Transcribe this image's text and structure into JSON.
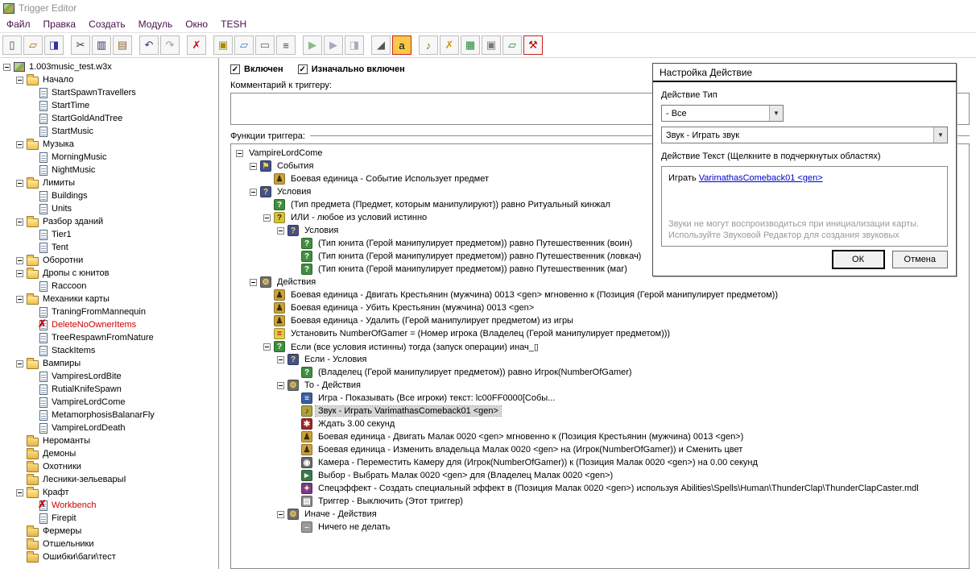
{
  "window": {
    "title": "Trigger Editor"
  },
  "menu": {
    "items": [
      "Файл",
      "Правка",
      "Создать",
      "Модуль",
      "Окно",
      "TESH"
    ]
  },
  "toolbar": {
    "buttons": [
      {
        "name": "new-map",
        "glyph": "▯",
        "color": "#334466"
      },
      {
        "name": "open-map",
        "glyph": "▱",
        "color": "#aa6600"
      },
      {
        "name": "save-map",
        "glyph": "◨",
        "color": "#333399"
      },
      {
        "name": "cut",
        "glyph": "✂",
        "color": "#333333",
        "sep": true
      },
      {
        "name": "copy",
        "glyph": "▥",
        "color": "#333366"
      },
      {
        "name": "paste",
        "glyph": "▤",
        "color": "#886633"
      },
      {
        "name": "undo",
        "glyph": "↶",
        "color": "#333388",
        "sep": true
      },
      {
        "name": "redo",
        "glyph": "↷",
        "color": "#9999aa"
      },
      {
        "name": "delete",
        "glyph": "✗",
        "color": "#cc0000",
        "sep": true
      },
      {
        "name": "new-category",
        "glyph": "▣",
        "color": "#aa8800",
        "sep": true
      },
      {
        "name": "new-trigger",
        "glyph": "▱",
        "color": "#3377cc"
      },
      {
        "name": "new-comment",
        "glyph": "▭",
        "color": "#666666"
      },
      {
        "name": "edit-script",
        "glyph": "≡",
        "color": "#444444"
      },
      {
        "name": "run-trigger",
        "glyph": "▶",
        "color": "#88bb88",
        "sep": true
      },
      {
        "name": "test-map",
        "glyph": "▶",
        "color": "#aaaabb"
      },
      {
        "name": "save-and-test",
        "glyph": "◨",
        "color": "#aaaabb"
      },
      {
        "name": "syntax-check",
        "glyph": "◢",
        "color": "#555555",
        "sep": true
      },
      {
        "name": "syntax-highlight",
        "glyph": "а",
        "color": "#000000",
        "bg": "#f7c948",
        "framed": true
      },
      {
        "name": "sound-manager",
        "glyph": "♪",
        "color": "#777700",
        "sep": true
      },
      {
        "name": "variables",
        "glyph": "✗",
        "color": "#cc9900"
      },
      {
        "name": "object-manager",
        "glyph": "▦",
        "color": "#228833"
      },
      {
        "name": "import-manager",
        "glyph": "▣",
        "color": "#777777"
      },
      {
        "name": "export-script",
        "glyph": "▱",
        "color": "#228833"
      },
      {
        "name": "tesh-settings",
        "glyph": "⚒",
        "color": "#bb0000",
        "framed": true
      }
    ]
  },
  "left_tree": {
    "items": [
      {
        "label": "1.003music_test.w3x",
        "depth": 0,
        "icon": "map",
        "expand": true
      },
      {
        "label": "Начало",
        "depth": 1,
        "icon": "folder-open",
        "expand": true
      },
      {
        "label": "StartSpawnTravellers",
        "depth": 2,
        "icon": "trigger"
      },
      {
        "label": "StartTime",
        "depth": 2,
        "icon": "trigger"
      },
      {
        "label": "StartGoldAndTree",
        "depth": 2,
        "icon": "trigger"
      },
      {
        "label": "StartMusic",
        "depth": 2,
        "icon": "trigger"
      },
      {
        "label": "Музыка",
        "depth": 1,
        "icon": "folder-open",
        "expand": true
      },
      {
        "label": "MorningMusic",
        "depth": 2,
        "icon": "trigger"
      },
      {
        "label": "NightMusic",
        "depth": 2,
        "icon": "trigger"
      },
      {
        "label": "Лимиты",
        "depth": 1,
        "icon": "folder-open",
        "expand": true
      },
      {
        "label": "Buildings",
        "depth": 2,
        "icon": "trigger"
      },
      {
        "label": "Units",
        "depth": 2,
        "icon": "trigger"
      },
      {
        "label": "Разбор зданий",
        "depth": 1,
        "icon": "folder-open",
        "expand": true
      },
      {
        "label": "Tier1",
        "depth": 2,
        "icon": "trigger"
      },
      {
        "label": "Tent",
        "depth": 2,
        "icon": "trigger"
      },
      {
        "label": "Оборотни",
        "depth": 1,
        "icon": "folder-open",
        "expand": true
      },
      {
        "label": "Дропы с юнитов",
        "depth": 1,
        "icon": "folder-open",
        "expand": true
      },
      {
        "label": "Raccoon",
        "depth": 2,
        "icon": "trigger"
      },
      {
        "label": "Механики карты",
        "depth": 1,
        "icon": "folder-open",
        "expand": true
      },
      {
        "label": "TraningFromMannequin",
        "depth": 2,
        "icon": "trigger"
      },
      {
        "label": "DeleteNoOwnerItems",
        "depth": 2,
        "icon": "trigger-disabled",
        "red": true
      },
      {
        "label": "TreeRespawnFromNature",
        "depth": 2,
        "icon": "trigger"
      },
      {
        "label": "StackItems",
        "depth": 2,
        "icon": "trigger"
      },
      {
        "label": "Вампиры",
        "depth": 1,
        "icon": "folder-open",
        "expand": true
      },
      {
        "label": "VampiresLordBite",
        "depth": 2,
        "icon": "trigger"
      },
      {
        "label": "RutialKnifeSpawn",
        "depth": 2,
        "icon": "trigger"
      },
      {
        "label": "VampireLordCome",
        "depth": 2,
        "icon": "trigger"
      },
      {
        "label": "MetamorphosisBalanarFly",
        "depth": 2,
        "icon": "trigger"
      },
      {
        "label": "VampireLordDeath",
        "depth": 2,
        "icon": "trigger"
      },
      {
        "label": "Нероманты",
        "depth": 1,
        "icon": "folder-closed"
      },
      {
        "label": "Демоны",
        "depth": 1,
        "icon": "folder-closed"
      },
      {
        "label": "Охотники",
        "depth": 1,
        "icon": "folder-closed"
      },
      {
        "label": "Лесники-зельеварыI",
        "depth": 1,
        "icon": "folder-closed"
      },
      {
        "label": "Крафт",
        "depth": 1,
        "icon": "folder-open",
        "expand": true
      },
      {
        "label": "Workbench",
        "depth": 2,
        "icon": "trigger-disabled",
        "red": true
      },
      {
        "label": "Firepit",
        "depth": 2,
        "icon": "trigger"
      },
      {
        "label": "Фермеры",
        "depth": 1,
        "icon": "folder-closed"
      },
      {
        "label": "Отшельники",
        "depth": 1,
        "icon": "folder-closed"
      },
      {
        "label": "Ошибки\\баги\\тест",
        "depth": 1,
        "icon": "folder-closed"
      }
    ]
  },
  "main": {
    "enabled_label": "Включен",
    "enabled_checked": true,
    "initially_on_label": "Изначально включен",
    "initially_on_checked": true,
    "comment_label": "Комментарий к триггеру:",
    "comment_value": "",
    "functions_label": "Функции триггера:"
  },
  "functions": {
    "items": [
      {
        "label": "VampireLordCome",
        "depth": 0,
        "icon": null,
        "expand": true
      },
      {
        "label": "События",
        "depth": 1,
        "icon": "events",
        "expand": true
      },
      {
        "label": "Боевая единица - Событие Использует предмет",
        "depth": 2,
        "icon": "unit-event"
      },
      {
        "label": "Условия",
        "depth": 1,
        "icon": "conditions",
        "expand": true
      },
      {
        "label": "(Тип предмета (Предмет, которым манипулируют)) равно Ритуальный кинжал",
        "depth": 2,
        "icon": "condition"
      },
      {
        "label": "ИЛИ - любое из условий истинно",
        "depth": 2,
        "icon": "or",
        "expand": true
      },
      {
        "label": "Условия",
        "depth": 3,
        "icon": "conditions",
        "expand": true
      },
      {
        "label": "(Тип юнита (Герой манипулирует предметом)) равно Путешественник (воин)",
        "depth": 4,
        "icon": "condition"
      },
      {
        "label": "(Тип юнита (Герой манипулирует предметом)) равно Путешественник (ловкач)",
        "depth": 4,
        "icon": "condition"
      },
      {
        "label": "(Тип юнита (Герой манипулирует предметом)) равно Путешественник (маг)",
        "depth": 4,
        "icon": "condition"
      },
      {
        "label": "Действия",
        "depth": 1,
        "icon": "actions",
        "expand": true
      },
      {
        "label": "Боевая единица - Двигать Крестьянин (мужчина) 0013 <gen> мгновенно к (Позиция (Герой манипулирует предметом))",
        "depth": 2,
        "icon": "unit-action"
      },
      {
        "label": "Боевая единица - Убить Крестьянин (мужчина) 0013 <gen>",
        "depth": 2,
        "icon": "unit-action"
      },
      {
        "label": "Боевая единица - Удалить (Герой манипулирует предметом) из игры",
        "depth": 2,
        "icon": "unit-action"
      },
      {
        "label": "Установить NumberOfGamer = (Номер игрока (Владелец (Герой манипулирует предметом)))",
        "depth": 2,
        "icon": "set-variable"
      },
      {
        "label": "Если (все условия истинны) тогда (запуск операции) инач_▯",
        "depth": 2,
        "icon": "if-then-else",
        "expand": true
      },
      {
        "label": "Если - Условия",
        "depth": 3,
        "icon": "conditions",
        "expand": true
      },
      {
        "label": "(Владелец (Герой манипулирует предметом)) равно Игрок(NumberOfGamer)",
        "depth": 4,
        "icon": "condition"
      },
      {
        "label": "То - Действия",
        "depth": 3,
        "icon": "actions",
        "expand": true
      },
      {
        "label": "Игра - Показывать (Все игроки) текст: lc00FF0000[Собы...",
        "depth": 4,
        "icon": "game-action"
      },
      {
        "label": "Звук - Играть VarimathasComeback01 <gen>",
        "depth": 4,
        "icon": "sound-action",
        "selected": true
      },
      {
        "label": "Ждать 3.00 секунд",
        "depth": 4,
        "icon": "wait-action"
      },
      {
        "label": "Боевая единица - Двигать Малак 0020 <gen> мгновенно к (Позиция Крестьянин (мужчина) 0013 <gen>)",
        "depth": 4,
        "icon": "unit-action"
      },
      {
        "label": "Боевая единица - Изменить владельца Малак 0020 <gen> на (Игрок(NumberOfGamer)) и Сменить цвет",
        "depth": 4,
        "icon": "unit-action"
      },
      {
        "label": "Камера - Переместить Камеру для (Игрок(NumberOfGamer)) к (Позиция Малак 0020 <gen>) на 0.00 секунд",
        "depth": 4,
        "icon": "camera-action"
      },
      {
        "label": "Выбор - Выбрать Малак 0020 <gen> для (Владелец Малак 0020 <gen>)",
        "depth": 4,
        "icon": "selection-action"
      },
      {
        "label": "Спецэффект - Создать специальный эффект в (Позиция Малак 0020 <gen>) используя Abilities\\Spells\\Human\\ThunderClap\\ThunderClapCaster.mdl",
        "depth": 4,
        "icon": "effect-action"
      },
      {
        "label": "Триггер - Выключить (Этот триггер)",
        "depth": 4,
        "icon": "trigger-action"
      },
      {
        "label": "Иначе - Действия",
        "depth": 3,
        "icon": "actions",
        "expand": true
      },
      {
        "label": "Ничего не делать",
        "depth": 4,
        "icon": "nothing-action"
      }
    ]
  },
  "dialog": {
    "title": "Настройка Действие",
    "type_label": "Действие Тип",
    "filter_value": "- Все",
    "action_value": "Звук - Играть звук",
    "text_label": "Действие Текст (Щелкните в подчеркнутых областях)",
    "action_text_prefix": "Играть ",
    "action_text_link": "VarimathasComeback01 <gen>",
    "hint_line1": "Звуки не могут воспроизводиться при инициализации карты.",
    "hint_line2": "Используйте Звуковой Редактор для создания звуковых",
    "ok_label": "ОК",
    "cancel_label": "Отмена"
  }
}
